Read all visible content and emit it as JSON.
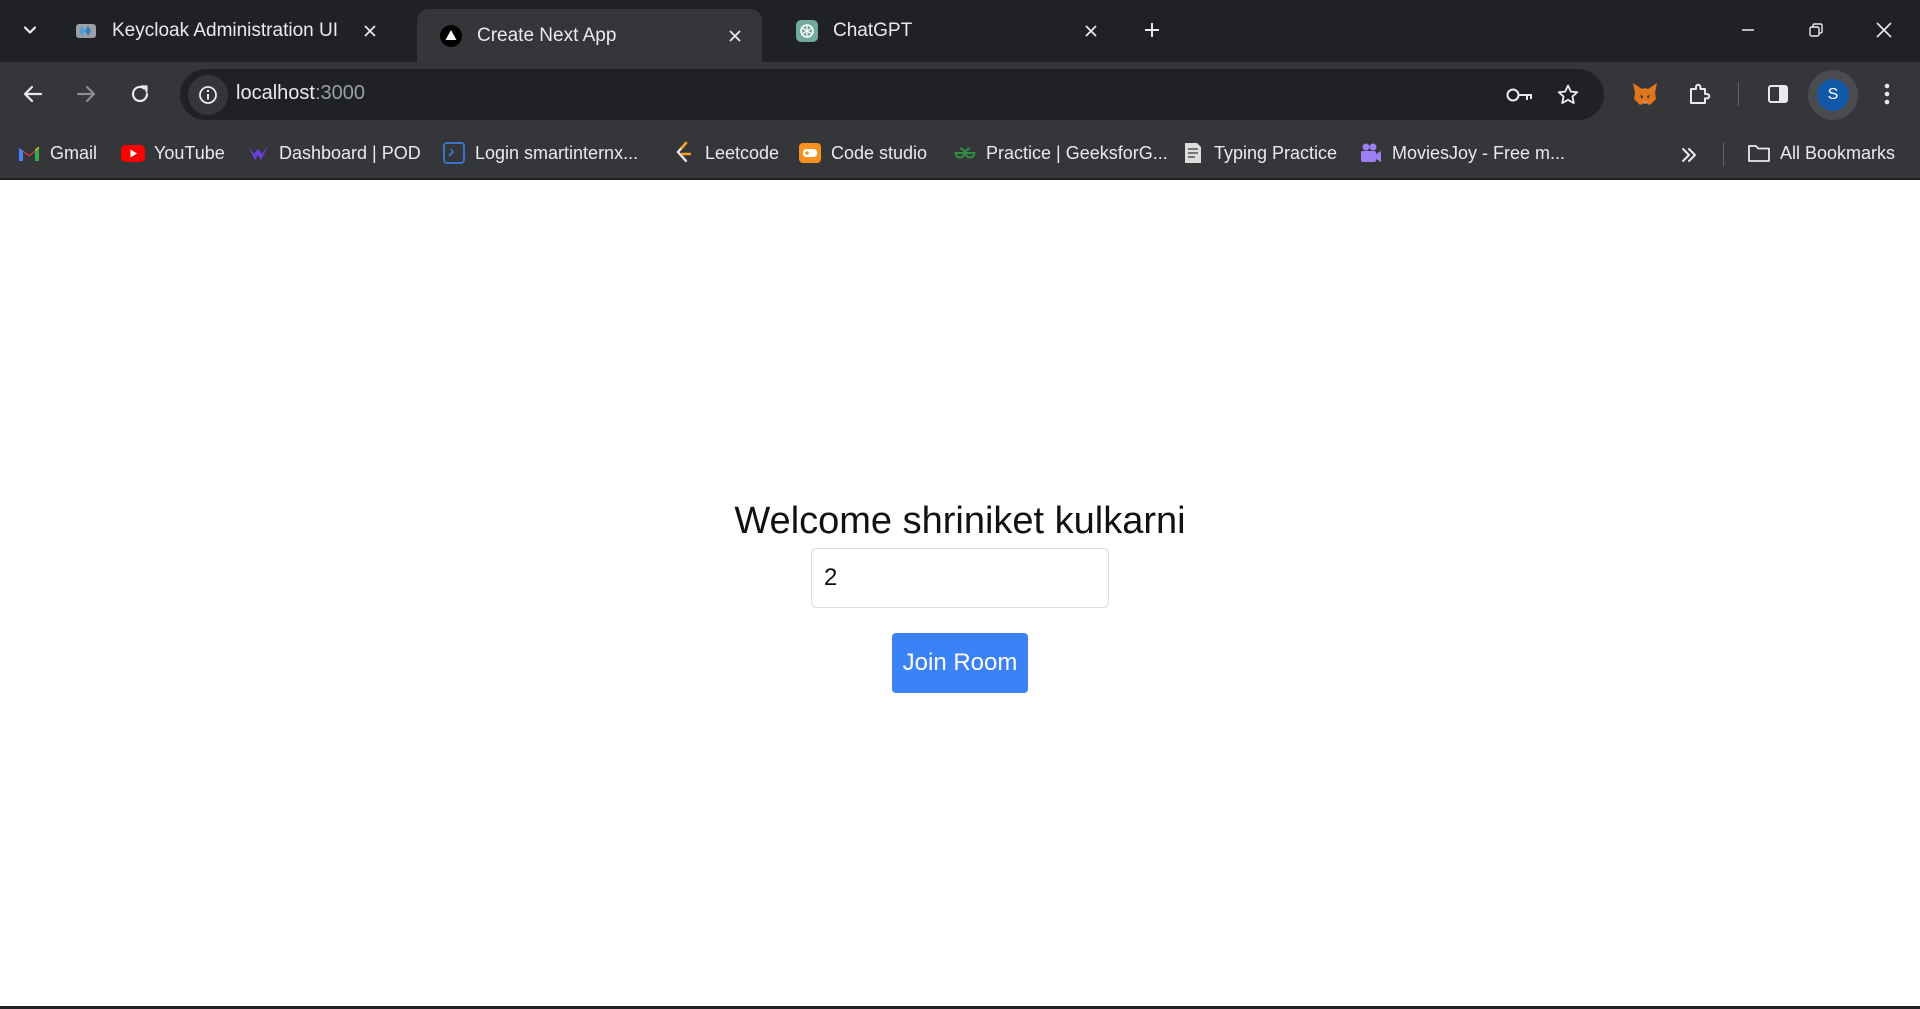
{
  "browser": {
    "tabs": [
      {
        "title": "Keycloak Administration UI",
        "favicon": "keycloak-icon",
        "active": false
      },
      {
        "title": "Create Next App",
        "favicon": "nextjs-icon",
        "active": true
      },
      {
        "title": "ChatGPT",
        "favicon": "chatgpt-icon",
        "active": false
      }
    ],
    "address": {
      "host": "localhost",
      "port": ":3000"
    },
    "profile_initial": "S",
    "bookmarks": [
      {
        "label": "Gmail",
        "icon": "gmail-icon"
      },
      {
        "label": "YouTube",
        "icon": "youtube-icon"
      },
      {
        "label": "Dashboard | POD",
        "icon": "pod-icon"
      },
      {
        "label": "Login smartinternx...",
        "icon": "smartinternz-icon"
      },
      {
        "label": "Leetcode",
        "icon": "leetcode-icon"
      },
      {
        "label": "Code studio",
        "icon": "codestudio-icon"
      },
      {
        "label": "Practice | GeeksforG...",
        "icon": "geeksforgeeks-icon"
      },
      {
        "label": "Typing Practice",
        "icon": "typing-icon"
      },
      {
        "label": "MoviesJoy - Free m...",
        "icon": "moviesjoy-icon"
      }
    ],
    "all_bookmarks_label": "All Bookmarks"
  },
  "page": {
    "welcome": "Welcome shriniket kulkarni",
    "room_input_value": "2",
    "join_button": "Join Room"
  },
  "colors": {
    "tab_strip_bg": "#202124",
    "toolbar_bg": "#35363a",
    "button_blue": "#3b82f6"
  }
}
